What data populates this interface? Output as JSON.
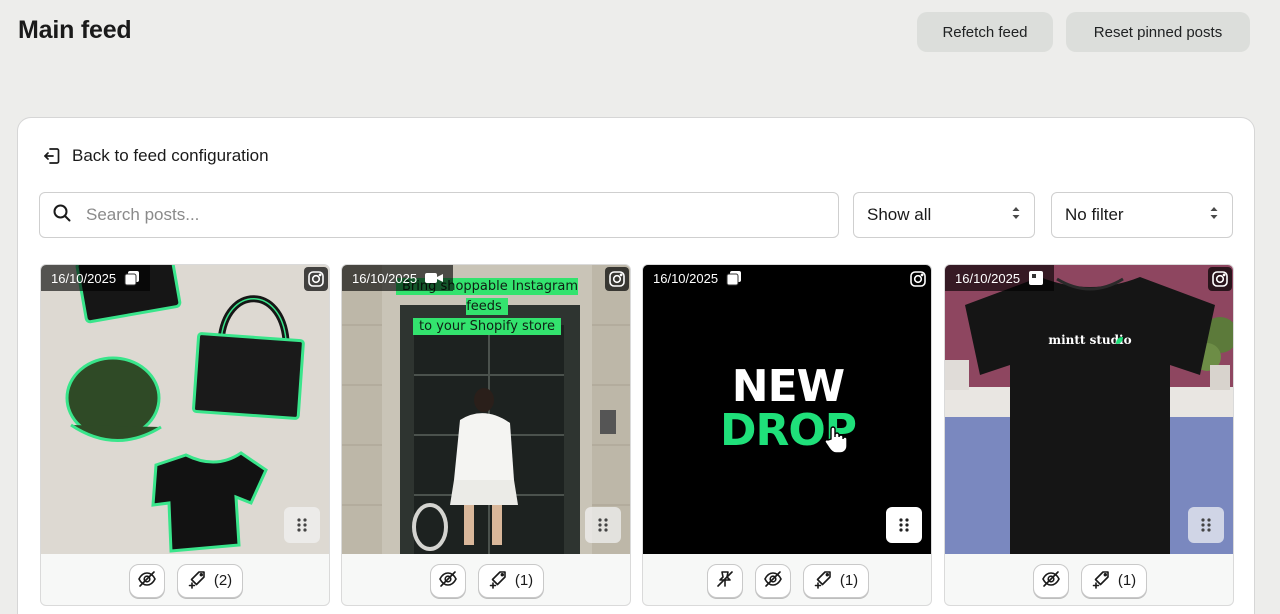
{
  "header": {
    "title": "Main feed",
    "refetch_label": "Refetch feed",
    "reset_label": "Reset pinned posts"
  },
  "card": {
    "back_label": "Back to feed configuration",
    "search": {
      "placeholder": "Search posts...",
      "value": ""
    },
    "show_select": {
      "value": "Show all"
    },
    "filter_select": {
      "value": "No filter"
    }
  },
  "posts": [
    {
      "date": "16/10/2025",
      "type_icon": "carousel-icon",
      "source_icon": "instagram-icon",
      "product_count": "(2)",
      "hidden_toggle": true,
      "pin_toggle": false
    },
    {
      "date": "16/10/2025",
      "type_icon": "video-icon",
      "source_icon": "instagram-icon",
      "product_count": "(1)",
      "hidden_toggle": true,
      "pin_toggle": false,
      "overlay_line1": "Bring shoppable Instagram feeds",
      "overlay_line2": "to your Shopify store"
    },
    {
      "date": "16/10/2025",
      "type_icon": "carousel-icon",
      "source_icon": "instagram-icon",
      "product_count": "(1)",
      "hidden_toggle": true,
      "pin_toggle": true,
      "headline1": "NEW",
      "headline2": "DROP"
    },
    {
      "date": "16/10/2025",
      "type_icon": "image-icon",
      "source_icon": "instagram-icon",
      "product_count": "(1)",
      "hidden_toggle": true,
      "pin_toggle": false,
      "brand": "mintt studio"
    }
  ],
  "colors": {
    "accent_green": "#1fe07a",
    "page_bg": "#ededeb",
    "card_bg": "#ffffff"
  }
}
